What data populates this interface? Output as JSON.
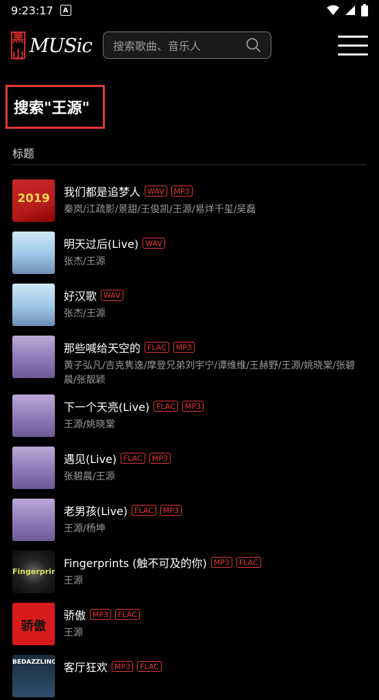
{
  "status_bar": {
    "time": "9:23:17",
    "sim_label": "A"
  },
  "header": {
    "logo_mark": "黑山",
    "logo_text": "MUSic",
    "search_placeholder": "搜索歌曲、音乐人"
  },
  "search_heading": "搜索\"王源\"",
  "section_label": "标题",
  "colors": {
    "badge": "#e53935",
    "highlight_box": "#e53935"
  },
  "songs": [
    {
      "title": "我们都是追梦人",
      "badges": [
        "WAV",
        "MP3"
      ],
      "artists": "秦岚/江疏影/景甜/王俊凯/王源/易烊千玺/吴磊",
      "cover": "red",
      "cover_text": "2019"
    },
    {
      "title": "明天过后(Live)",
      "badges": [
        "WAV"
      ],
      "artists": "张杰/王源",
      "cover": "light-blue",
      "cover_text": ""
    },
    {
      "title": "好汉歌",
      "badges": [
        "WAV"
      ],
      "artists": "张杰/王源",
      "cover": "light-blue",
      "cover_text": ""
    },
    {
      "title": "那些喊给天空的",
      "badges": [
        "FLAC",
        "MP3"
      ],
      "artists": "黄子弘凡/吉克隽逸/摩登兄弟刘宇宁/谭维维/王赫野/王源/姚晓棠/张碧晨/张靓颖",
      "cover": "purple",
      "cover_text": ""
    },
    {
      "title": "下一个天亮(Live)",
      "badges": [
        "FLAC",
        "MP3"
      ],
      "artists": "王源/姚晓棠",
      "cover": "purple",
      "cover_text": ""
    },
    {
      "title": "遇见(Live)",
      "badges": [
        "FLAC",
        "MP3"
      ],
      "artists": "张碧晨/王源",
      "cover": "purple",
      "cover_text": ""
    },
    {
      "title": "老男孩(Live)",
      "badges": [
        "FLAC",
        "MP3"
      ],
      "artists": "王源/杨坤",
      "cover": "purple",
      "cover_text": ""
    },
    {
      "title": "Fingerprints (触不可及的你)",
      "badges": [
        "MP3",
        "FLAC"
      ],
      "artists": "王源",
      "cover": "dark",
      "cover_text": "Fingerprints"
    },
    {
      "title": "骄傲",
      "badges": [
        "MP3",
        "FLAC"
      ],
      "artists": "王源",
      "cover": "red-solid",
      "cover_text": "骄傲"
    },
    {
      "title": "客厅狂欢",
      "badges": [
        "MP3",
        "FLAC"
      ],
      "artists": "",
      "cover": "dark-blue",
      "cover_text": "BEDAZZLING"
    }
  ]
}
